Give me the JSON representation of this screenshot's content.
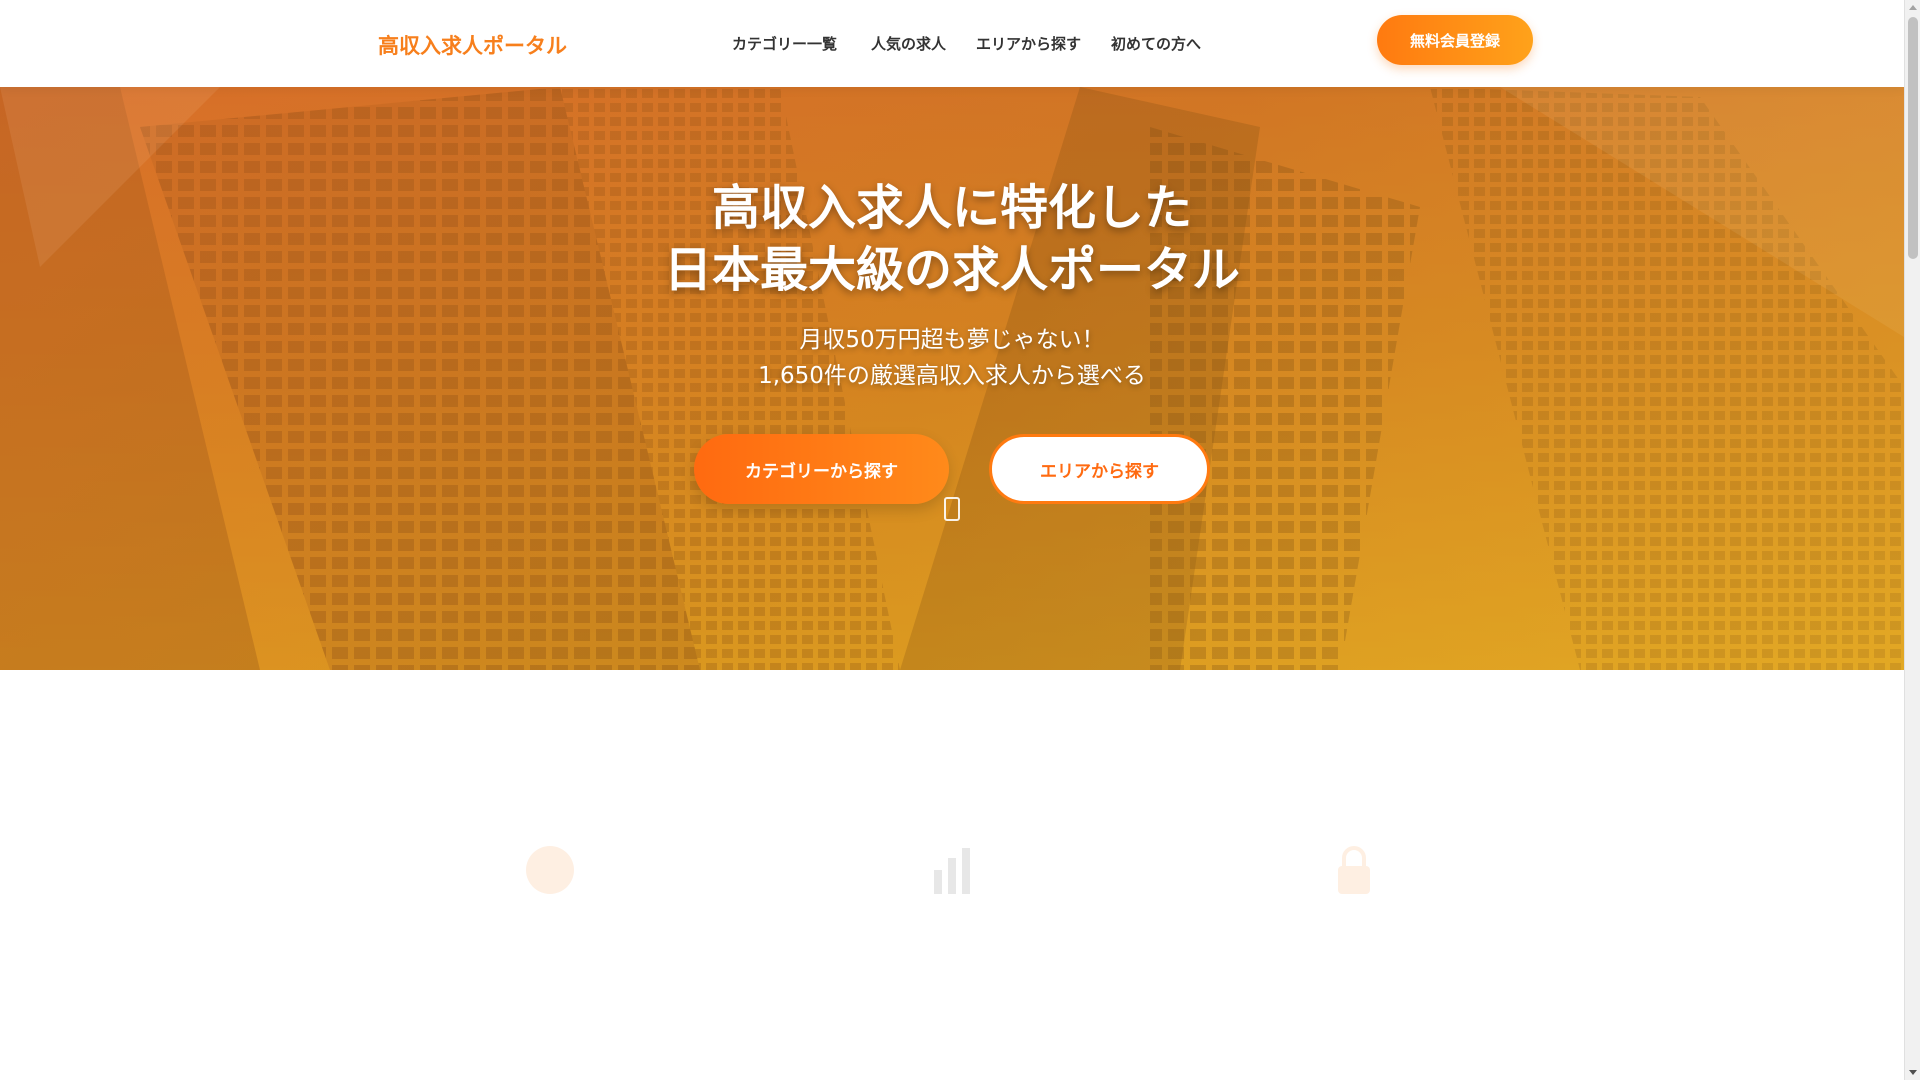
{
  "header": {
    "logo_icon": "briefcase-icon",
    "logo_glyph": "",
    "logo_text": "高収入求人ポータル",
    "nav": [
      {
        "label": "カテゴリー一覧",
        "caret": ""
      },
      {
        "label": "人気の求人"
      },
      {
        "label": "エリアから探す"
      },
      {
        "label": "初めての方へ"
      }
    ],
    "register_label": "無料会員登録"
  },
  "hero": {
    "title_line1": "高収入求人に特化した",
    "title_line2": "日本最大級の求人ポータル",
    "sub_line1": "月収50万円超も夢じゃない！",
    "sub_line2": "1,650件の厳選高収入求人から選べる",
    "btn_category": "カテゴリーから探す",
    "btn_area": "エリアから探す",
    "scroll_icon": "scroll-down-icon"
  },
  "colors": {
    "accent": "#f77f1c",
    "hero_tint": "#d8891f"
  }
}
